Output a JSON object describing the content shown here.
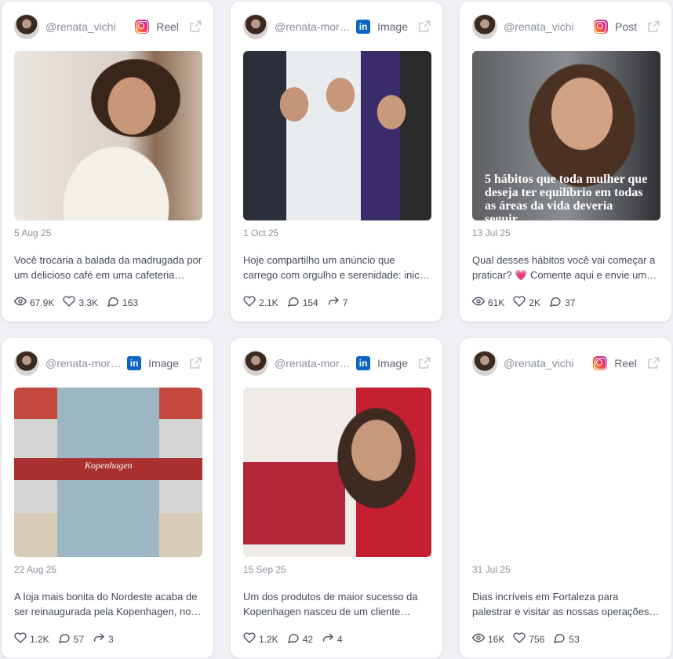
{
  "posts": [
    {
      "handle": "@renata_vichi",
      "platform": "instagram",
      "type": "Reel",
      "date": "5 Aug 25",
      "caption": "Você trocaria a balada da madrugada por um delicioso café em uma cafeteria legal?",
      "views": "67.9K",
      "likes": "3.3K",
      "comments": "163",
      "shares": null,
      "image": "woman-white-sweater"
    },
    {
      "handle": "@renata-moreira",
      "platform": "linkedin",
      "type": "Image",
      "date": "1 Oct 25",
      "caption": "Hoje compartilho um anúncio que carrego com orgulho e serenidade: iniciei uma nova fase",
      "views": null,
      "likes": "2.1K",
      "comments": "154",
      "shares": "7",
      "image": "three-people"
    },
    {
      "handle": "@renata_vichi",
      "platform": "instagram",
      "type": "Post",
      "date": "13 Jul 25",
      "caption": "Qual desses hábitos você vai começar a praticar? 💗 Comente aqui e envie um comentário",
      "views": "61K",
      "likes": "2K",
      "comments": "37",
      "shares": null,
      "image": "woman-laughing",
      "overlay": "5 hábitos que toda mulher que deseja ter equilíbrio em todas as áreas da vida deveria seguir"
    },
    {
      "handle": "@renata-moreira",
      "platform": "linkedin",
      "type": "Image",
      "date": "22 Aug 25",
      "caption": "A loja mais bonita do Nordeste acaba de ser reinaugurada pela Kopenhagen, no shopping",
      "views": null,
      "likes": "1.2K",
      "comments": "57",
      "shares": "3",
      "image": "store",
      "sign": "Kopenhagen"
    },
    {
      "handle": "@renata-moreira",
      "platform": "linkedin",
      "type": "Image",
      "date": "15 Sep 25",
      "caption": "Um dos produtos de maior sucesso da Kopenhagen nasceu de um cliente apaixonado",
      "views": null,
      "likes": "1.2K",
      "comments": "42",
      "shares": "4",
      "image": "woman-box"
    },
    {
      "handle": "@renata_vichi",
      "platform": "instagram",
      "type": "Reel",
      "date": "31 Jul 25",
      "caption": "Dias incríveis em Fortaleza para palestrar e visitar as nossas operações de loja",
      "views": "16K",
      "likes": "756",
      "comments": "53",
      "shares": null,
      "image": "blank"
    }
  ],
  "colors": {
    "instagram": "#e0287b",
    "linkedin": "#0a66c2",
    "text": "#444b57",
    "muted": "#8a909b"
  }
}
